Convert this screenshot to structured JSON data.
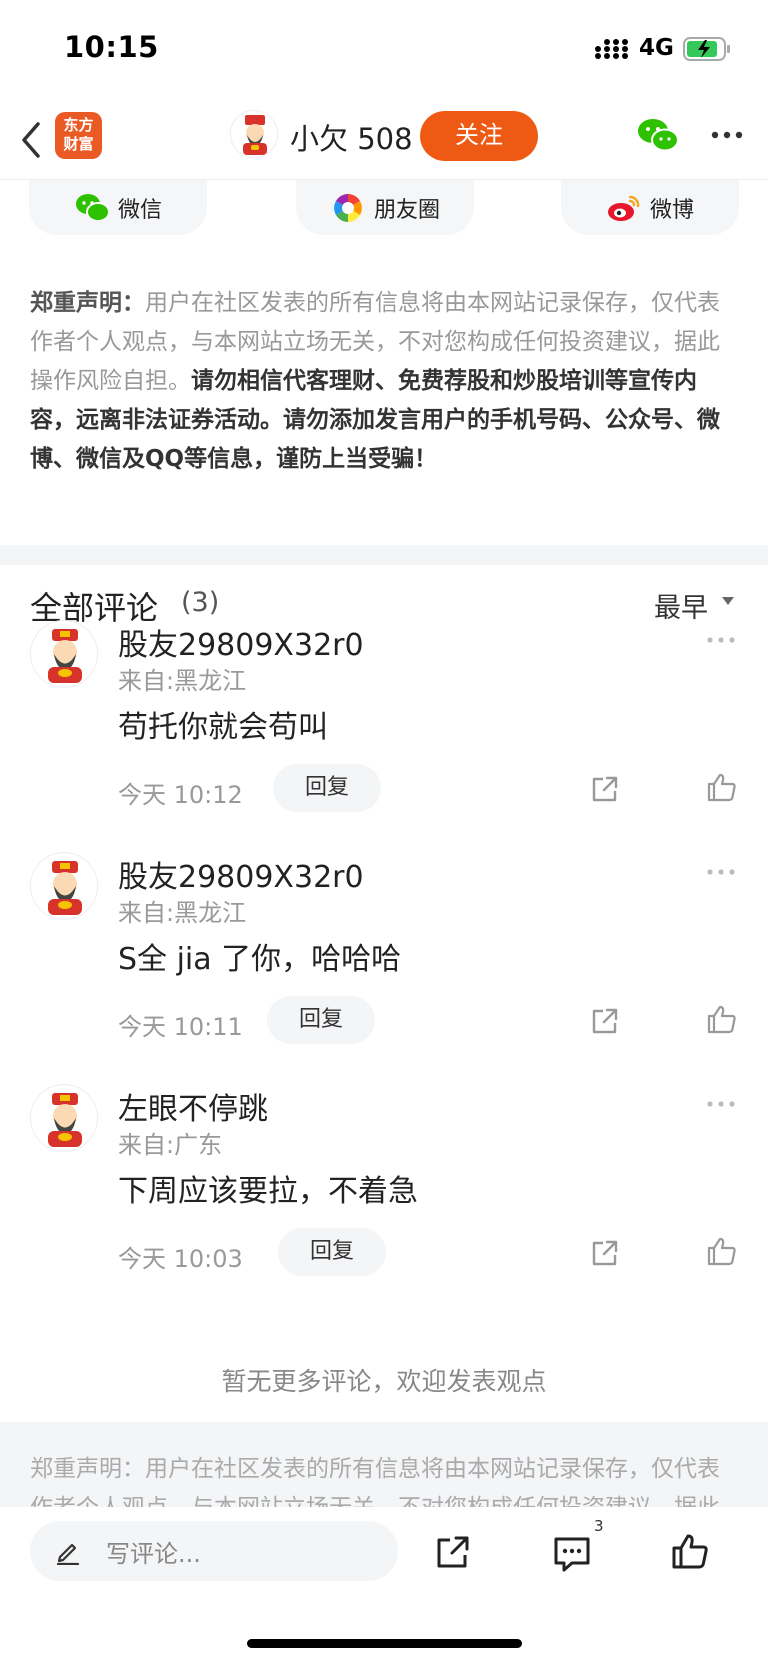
{
  "status_bar": {
    "time": "10:15",
    "network": "4G"
  },
  "header": {
    "logo_line1": "东方",
    "logo_line2": "财富",
    "username": "小欠 508",
    "follow_label": "关注"
  },
  "share": {
    "wechat": "微信",
    "moments": "朋友圈",
    "weibo": "微博"
  },
  "disclaimer": {
    "label": "郑重声明：",
    "normal": "用户在社区发表的所有信息将由本网站记录保存，仅代表作者个人观点，与本网站立场无关，不对您构成任何投资建议，据此操作风险自担。",
    "bold": "请勿相信代客理财、免费荐股和炒股培训等宣传内容，远离非法证券活动。请勿添加发言用户的手机号码、公众号、微博、微信及QQ等信息，谨防上当受骗！"
  },
  "comments_section": {
    "title": "全部评论",
    "count": "(3)",
    "sort_label": "最早"
  },
  "comments": [
    {
      "name": "股友29809X32r0",
      "location": "来自:黑龙江",
      "text": "苟托你就会苟叫",
      "time": "今天 10:12",
      "reply": "回复"
    },
    {
      "name": "股友29809X32r0",
      "location": "来自:黑龙江",
      "text": "S全 jia 了你，哈哈哈",
      "time": "今天 10:11",
      "reply": "回复"
    },
    {
      "name": "左眼不停跳",
      "location": "来自:广东",
      "text": "下周应该要拉，不着急",
      "time": "今天 10:03",
      "reply": "回复"
    }
  ],
  "no_more_text": "暂无更多评论，欢迎发表观点",
  "footer_disclaimer": "郑重声明：用户在社区发表的所有信息将由本网站记录保存，仅代表作者个人观点，与本网站立场无关，不对您构成任何投资建议，据此操作风险自担。",
  "bottom_bar": {
    "input_placeholder": "写评论...",
    "comment_badge": "3"
  },
  "colors": {
    "accent": "#ee5a13",
    "logo_bg": "#ea5a25",
    "wechat_green": "#2dc100",
    "weibo_red": "#e6162d"
  },
  "icons": [
    "back-icon",
    "wechat-icon",
    "more-icon",
    "moments-icon",
    "weibo-icon",
    "share-icon",
    "like-icon",
    "comment-icon",
    "pen-icon"
  ]
}
